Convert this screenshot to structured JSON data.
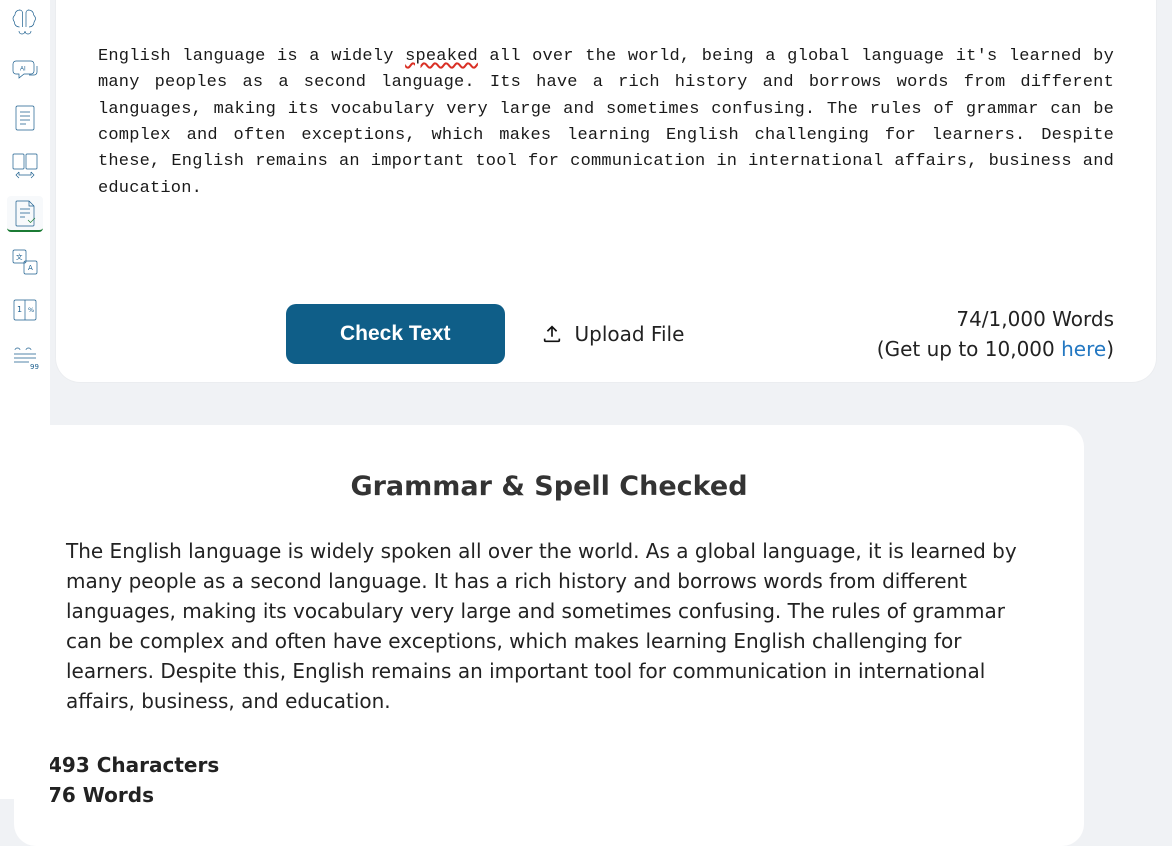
{
  "sidebar": {
    "tools": [
      {
        "name": "brain-icon"
      },
      {
        "name": "ai-chat-icon"
      },
      {
        "name": "document-list-icon"
      },
      {
        "name": "diff-compare-icon"
      },
      {
        "name": "grammar-check-icon"
      },
      {
        "name": "translate-icon"
      },
      {
        "name": "columns-icon"
      },
      {
        "name": "quote-icon"
      }
    ]
  },
  "editor": {
    "pre_error": "English language is a widely ",
    "error_word": "speaked",
    "post_error": " all over the world, being a global language it's learned by many peoples as a second language. Its have a rich history and borrows words from different languages, making its vocabulary very large and sometimes confusing. The rules of grammar can be complex and often exceptions, which makes learning English challenging for learners. Despite these, English remains an important tool for communication in international affairs, business and education."
  },
  "actions": {
    "check_label": "Check Text",
    "upload_label": "Upload File"
  },
  "wordcount": {
    "counter": "74/1,000 Words",
    "upsell_prefix": "(Get up to 10,000 ",
    "upsell_link": "here",
    "upsell_suffix": ")"
  },
  "result": {
    "title": "Grammar & Spell Checked",
    "body": "The English language is widely spoken all over the world. As a global language, it is learned by many people as a second language. It has a rich history and borrows words from different languages, making its vocabulary very large and sometimes confusing. The rules of grammar can be complex and often have exceptions, which makes learning English challenging for learners. Despite this, English remains an important tool for communication in international affairs, business, and education.",
    "chars_label": "493 Characters",
    "words_label": "76 Words"
  }
}
